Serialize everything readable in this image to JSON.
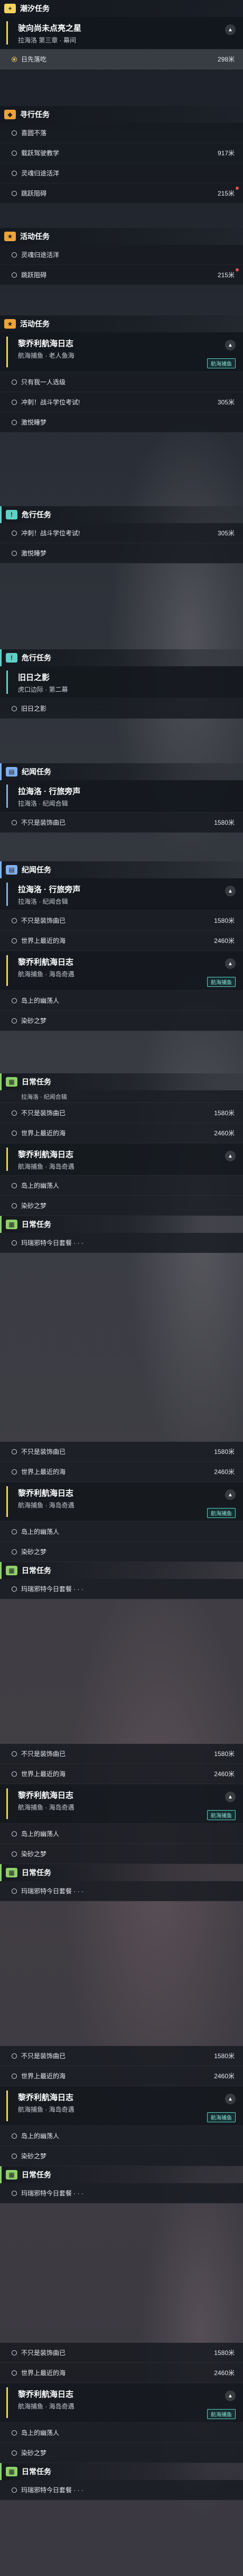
{
  "s1": {
    "header": "潮汐任务",
    "quest_title": "驶向尚未点亮之星",
    "quest_sub": "拉海洛 第三章 · 幕间",
    "row_label": "日先落吃",
    "row_dist": "298米"
  },
  "s2": {
    "header": "寻行任务",
    "rows": [
      {
        "label": "喜圆不落",
        "dist": ""
      },
      {
        "label": "载跃驾驶教学",
        "dist": "917米"
      },
      {
        "label": "灵魂归途活洋",
        "dist": ""
      },
      {
        "label": "跳跃阻碍",
        "dist": "215米"
      }
    ]
  },
  "s3": {
    "header": "活动任务",
    "rows": [
      {
        "label": "灵魂归途活洋",
        "dist": ""
      },
      {
        "label": "跳跃阻碍",
        "dist": "215米"
      }
    ]
  },
  "s4": {
    "header": "活动任务",
    "quest_title": "黎乔利航海日志",
    "quest_sub": "航海捕鱼 · 老人鱼海",
    "badge": "航海捕鱼",
    "rows": [
      {
        "label": "只有我一人选级",
        "dist": ""
      },
      {
        "label": "冲刺！战斗学位考试!",
        "dist": "305米"
      },
      {
        "label": "激悦睡梦",
        "dist": ""
      }
    ]
  },
  "s5": {
    "header": "危行任务",
    "rows": [
      {
        "label": "冲刺！战斗学位考试!",
        "dist": "305米"
      },
      {
        "label": "激悦睡梦",
        "dist": ""
      }
    ]
  },
  "s6": {
    "header": "危行任务",
    "quest_title": "旧日之影",
    "quest_sub": "虎口边际 · 第二幕",
    "row_label": "旧日之影"
  },
  "s7": {
    "header": "纪闻任务",
    "quest_title": "拉海洛 · 行旅旁声",
    "quest_sub": "拉海洛 · 纪闻合辑",
    "row_label": "不只是装饰曲已",
    "row_dist": "1580米"
  },
  "s8": {
    "header": "纪闻任务",
    "quest_title": "拉海洛 · 行旅旁声",
    "quest_sub": "拉海洛 · 纪闻合辑",
    "rows": [
      {
        "label": "不只是装饰曲已",
        "dist": "1580米"
      },
      {
        "label": "世界上最近的海",
        "dist": "2460米"
      }
    ],
    "q2_title": "黎乔利航海日志",
    "q2_sub": "航海捕鱼 · 海岛奇遇",
    "q2_badge": "航海捕鱼",
    "rows2": [
      {
        "label": "岛上的幽荡人"
      },
      {
        "label": "染砂之梦"
      }
    ]
  },
  "s9": {
    "header": "日常任务",
    "header_top": "拉海洛 · 纪闻合辑",
    "rows": [
      {
        "label": "不只是装饰曲已",
        "dist": "1580米"
      },
      {
        "label": "世界上最近的海",
        "dist": "2460米"
      }
    ],
    "q2_title": "黎乔利航海日志",
    "q2_sub": "航海捕鱼 · 海岛奇遇",
    "rows2": [
      {
        "label": "岛上的幽荡人"
      },
      {
        "label": "染砂之梦"
      }
    ],
    "header2": "日常任务",
    "row3": "玛瑞邪特今日套餐 · · ·"
  },
  "rep": {
    "rows": [
      {
        "label": "不只是装饰曲已",
        "dist": "1580米"
      },
      {
        "label": "世界上最近的海",
        "dist": "2460米"
      }
    ],
    "q_title": "黎乔利航海日志",
    "q_sub": "航海捕鱼 · 海岛奇遇",
    "q_badge": "航海捕鱼",
    "rows2": [
      {
        "label": "岛上的幽荡人"
      },
      {
        "label": "染砂之梦"
      }
    ],
    "header": "日常任务",
    "row3": "玛瑞邪特今日套餐 · · ·"
  },
  "icons": {
    "tide": "plus-icon",
    "seek": "diamond-icon",
    "event": "star-icon",
    "danger": "warning-icon",
    "record": "book-icon",
    "daily": "calendar-icon"
  }
}
